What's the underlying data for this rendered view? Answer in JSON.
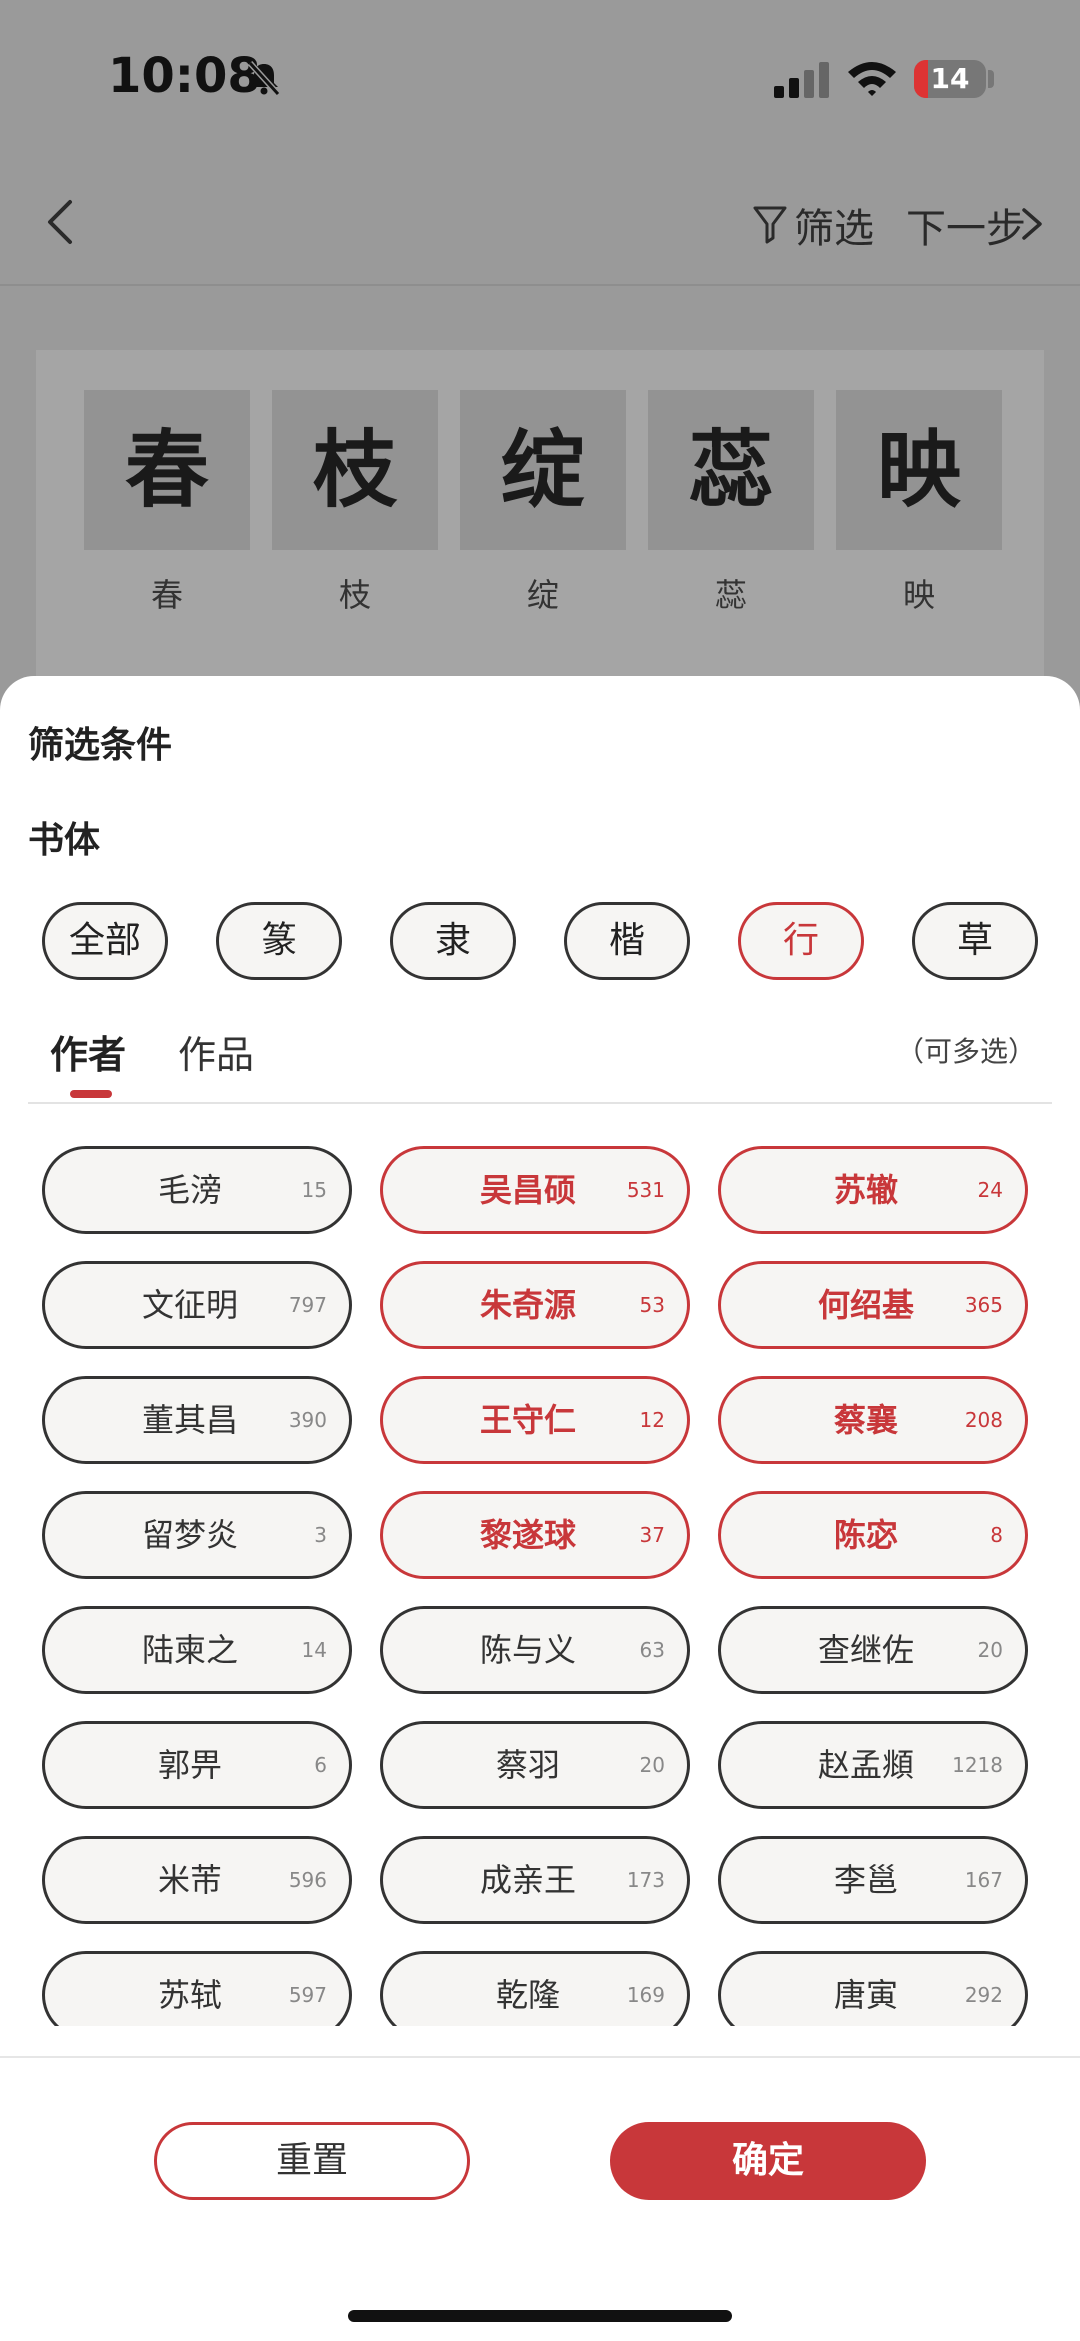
{
  "status_bar": {
    "time": "10:08",
    "battery": "14"
  },
  "nav": {
    "filter_label": "筛选",
    "next_label": "下一步"
  },
  "preview": {
    "chars": [
      {
        "glyph": "春",
        "label": "春"
      },
      {
        "glyph": "枝",
        "label": "枝"
      },
      {
        "glyph": "绽",
        "label": "绽"
      },
      {
        "glyph": "蕊",
        "label": "蕊"
      },
      {
        "glyph": "映",
        "label": "映"
      }
    ]
  },
  "sheet": {
    "title": "筛选条件",
    "style_title": "书体",
    "styles": [
      {
        "label": "全部",
        "selected": false
      },
      {
        "label": "篆",
        "selected": false
      },
      {
        "label": "隶",
        "selected": false
      },
      {
        "label": "楷",
        "selected": false
      },
      {
        "label": "行",
        "selected": true
      },
      {
        "label": "草",
        "selected": false
      }
    ],
    "tabs": {
      "author": "作者",
      "works": "作品",
      "hint": "（可多选）"
    },
    "authors": [
      {
        "name": "毛滂",
        "count": "15",
        "selected": false
      },
      {
        "name": "吴昌硕",
        "count": "531",
        "selected": true
      },
      {
        "name": "苏辙",
        "count": "24",
        "selected": true
      },
      {
        "name": "文征明",
        "count": "797",
        "selected": false
      },
      {
        "name": "朱奇源",
        "count": "53",
        "selected": true
      },
      {
        "name": "何绍基",
        "count": "365",
        "selected": true
      },
      {
        "name": "董其昌",
        "count": "390",
        "selected": false
      },
      {
        "name": "王守仁",
        "count": "12",
        "selected": true
      },
      {
        "name": "蔡襄",
        "count": "208",
        "selected": true
      },
      {
        "name": "留梦炎",
        "count": "3",
        "selected": false
      },
      {
        "name": "黎遂球",
        "count": "37",
        "selected": true
      },
      {
        "name": "陈宓",
        "count": "8",
        "selected": true
      },
      {
        "name": "陆柬之",
        "count": "14",
        "selected": false
      },
      {
        "name": "陈与义",
        "count": "63",
        "selected": false
      },
      {
        "name": "查继佐",
        "count": "20",
        "selected": false
      },
      {
        "name": "郭畀",
        "count": "6",
        "selected": false
      },
      {
        "name": "蔡羽",
        "count": "20",
        "selected": false
      },
      {
        "name": "赵孟頫",
        "count": "1218",
        "selected": false
      },
      {
        "name": "米芾",
        "count": "596",
        "selected": false
      },
      {
        "name": "成亲王",
        "count": "173",
        "selected": false
      },
      {
        "name": "李邕",
        "count": "167",
        "selected": false
      },
      {
        "name": "苏轼",
        "count": "597",
        "selected": false
      },
      {
        "name": "乾隆",
        "count": "169",
        "selected": false
      },
      {
        "name": "唐寅",
        "count": "292",
        "selected": false
      }
    ],
    "reset_label": "重置",
    "confirm_label": "确定"
  },
  "colors": {
    "accent": "#c8373a",
    "overlay": "#9a9a9a"
  }
}
